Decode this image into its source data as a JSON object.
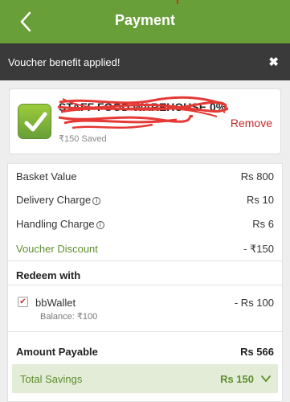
{
  "header": {
    "title": "Payment",
    "back_icon": "chevron-left-icon"
  },
  "toast": {
    "message": "Voucher benefit applied!",
    "close_symbol": "✖"
  },
  "voucher": {
    "code_text": "STAFF FOOD WAREHOUSE 0%",
    "saved_text": "₹150 Saved",
    "remove_label": "Remove",
    "icon": "check-icon"
  },
  "summary": {
    "rows": [
      {
        "label": "Basket Value",
        "value": "Rs 800",
        "info": false
      },
      {
        "label": "Delivery Charge",
        "value": "Rs 10",
        "info": true
      },
      {
        "label": "Handling Charge",
        "value": "Rs 6",
        "info": true
      },
      {
        "label": "Voucher Discount",
        "value": "- ₹150",
        "info": false
      }
    ],
    "info_symbol": "i",
    "redeem_title": "Redeem with",
    "wallet": {
      "name": "bbWallet",
      "balance": "Balance: ₹100",
      "amount": "- Rs 100",
      "checked_symbol": "✔"
    },
    "amount_payable": {
      "label": "Amount Payable",
      "value": "Rs 566"
    },
    "total_savings": {
      "label": "Total Savings",
      "value": "Rs 150",
      "icon": "chevron-down-icon"
    }
  },
  "colors": {
    "brand_green": "#689f38",
    "remove_red": "#c62828",
    "toast_bg": "#3a3a3a"
  }
}
